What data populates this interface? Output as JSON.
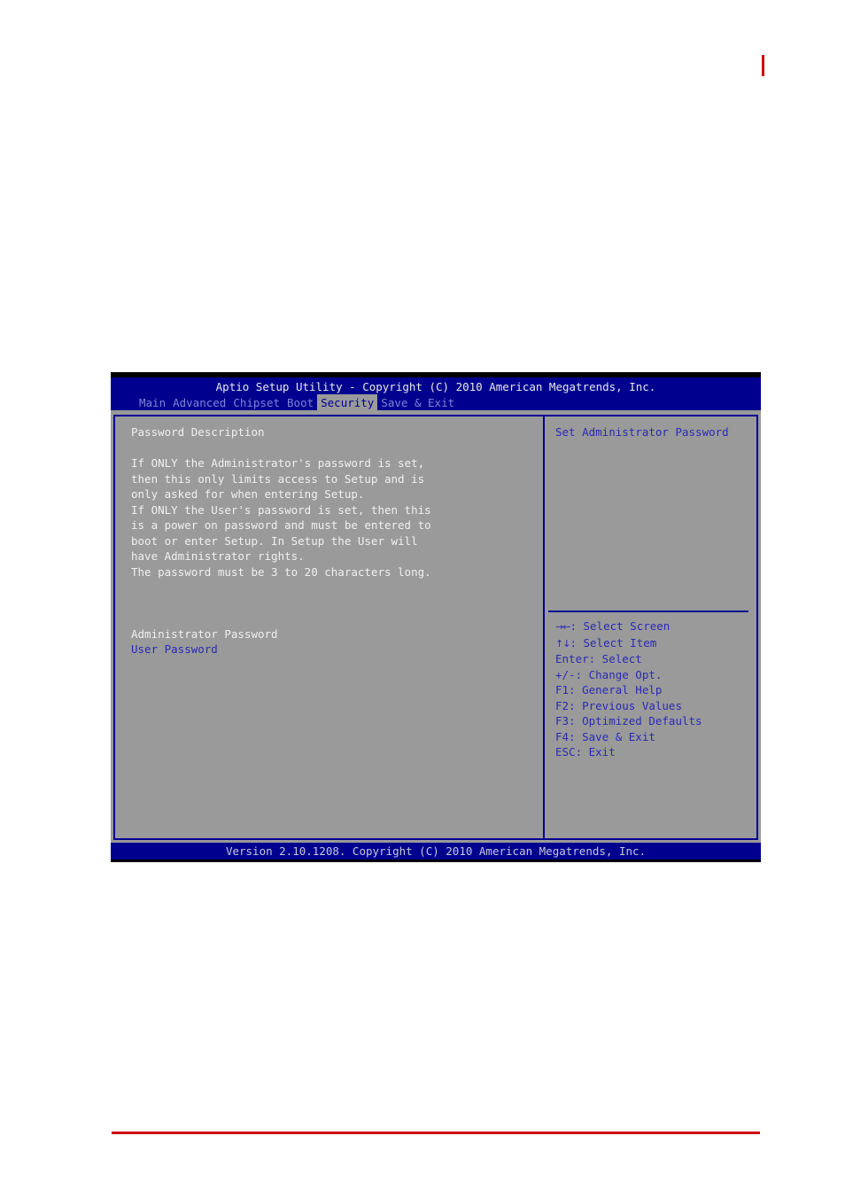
{
  "page": {
    "red_mark": "vertical-red-change-bar",
    "red_rule": "bottom-red-rule"
  },
  "bios": {
    "title": "Aptio Setup Utility - Copyright (C) 2010 American Megatrends, Inc.",
    "menu": [
      {
        "label": "Main",
        "active": false
      },
      {
        "label": "Advanced",
        "active": false
      },
      {
        "label": "Chipset",
        "active": false
      },
      {
        "label": "Boot",
        "active": false
      },
      {
        "label": "Security",
        "active": true
      },
      {
        "label": "Save & Exit",
        "active": false
      }
    ],
    "left_pane": {
      "heading": "Password Description",
      "description_lines": [
        "If ONLY the Administrator's password is set,",
        "then this only limits access to Setup and is",
        "only asked for when entering Setup.",
        "If ONLY the User's password is set, then this",
        "is a power on password and must be entered to",
        "boot or enter Setup. In Setup the User will",
        "have Administrator rights.",
        "The password must be 3 to 20 characters long."
      ],
      "items": [
        {
          "label": "Administrator Password",
          "selected": true
        },
        {
          "label": "User Password",
          "selected": false
        }
      ]
    },
    "right_pane": {
      "help_text": "Set Administrator Password",
      "keys": [
        {
          "glyph": "→←",
          "text": ": Select Screen"
        },
        {
          "glyph": "↑↓",
          "text": ": Select Item"
        },
        {
          "glyph": "",
          "text": "Enter: Select"
        },
        {
          "glyph": "",
          "text": "+/-: Change Opt."
        },
        {
          "glyph": "",
          "text": "F1: General Help"
        },
        {
          "glyph": "",
          "text": "F2: Previous Values"
        },
        {
          "glyph": "",
          "text": "F3: Optimized Defaults"
        },
        {
          "glyph": "",
          "text": "F4: Save & Exit"
        },
        {
          "glyph": "",
          "text": "ESC: Exit"
        }
      ]
    },
    "footer": "Version 2.10.1208. Copyright (C) 2010 American Megatrends, Inc.",
    "colors": {
      "header_blue": "#00008f",
      "body_gray": "#9a9a9a",
      "text_blue": "#2a2ab4",
      "text_white": "#f0f0f0",
      "menu_blue": "#7d84d8",
      "accent_red": "#cc0000"
    }
  }
}
